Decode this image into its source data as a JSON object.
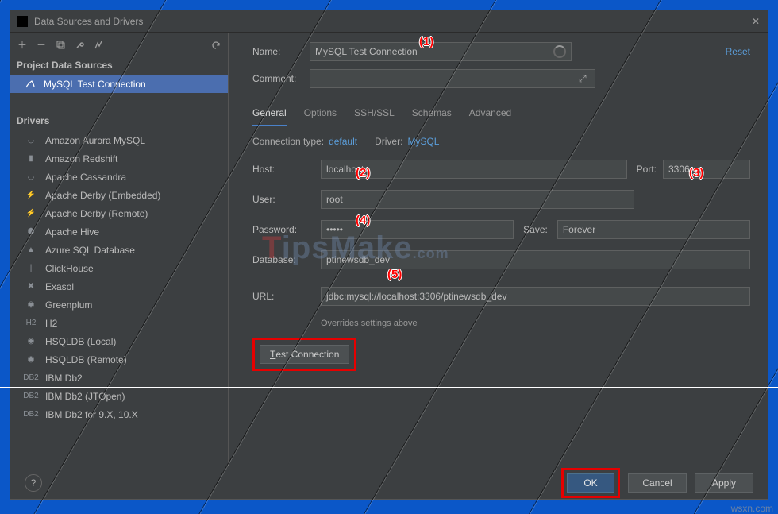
{
  "window": {
    "title": "Data Sources and Drivers"
  },
  "toolbar": {
    "reset": "Reset"
  },
  "left": {
    "section_ds": "Project Data Sources",
    "ds_items": [
      "MySQL Test Connection"
    ],
    "section_drv": "Drivers",
    "drivers": [
      "Amazon Aurora MySQL",
      "Amazon Redshift",
      "Apache Cassandra",
      "Apache Derby (Embedded)",
      "Apache Derby (Remote)",
      "Apache Hive",
      "Azure SQL Database",
      "ClickHouse",
      "Exasol",
      "Greenplum",
      "H2",
      "HSQLDB (Local)",
      "HSQLDB (Remote)",
      "IBM Db2",
      "IBM Db2 (JTOpen)",
      "IBM Db2 for 9.X, 10.X"
    ]
  },
  "form": {
    "name_label": "Name:",
    "name_value": "MySQL Test Connection",
    "comment_label": "Comment:",
    "tabs": [
      "General",
      "Options",
      "SSH/SSL",
      "Schemas",
      "Advanced"
    ],
    "ct_label": "Connection type:",
    "ct_value": "default",
    "driver_label": "Driver:",
    "driver_value": "MySQL",
    "host_label": "Host:",
    "host_value": "localhost",
    "port_label": "Port:",
    "port_value": "3306",
    "user_label": "User:",
    "user_value": "root",
    "password_label": "Password:",
    "password_value": "•••••",
    "save_label": "Save:",
    "save_value": "Forever",
    "database_label": "Database:",
    "database_value": "ptinewsdb_dev",
    "url_label": "URL:",
    "url_value": "jdbc:mysql://localhost:3306/ptinewsdb_dev",
    "overrides": "Overrides settings above",
    "test_btn": "Test Connection"
  },
  "footer": {
    "ok": "OK",
    "cancel": "Cancel",
    "apply": "Apply"
  },
  "markers": [
    "(1)",
    "(2)",
    "(3)",
    "(4)",
    "(5)"
  ],
  "watermark": "TipsMake",
  "watermark_suffix": ".com",
  "wsxn": "wsxn.com"
}
